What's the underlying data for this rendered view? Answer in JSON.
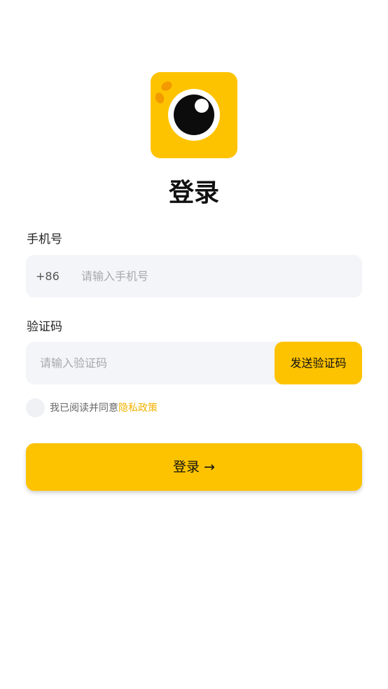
{
  "logo": {
    "icon": "camera-lens-icon",
    "color": "#fec300"
  },
  "title": "登录",
  "phone": {
    "label": "手机号",
    "prefix": "+86",
    "placeholder": "请输入手机号",
    "value": ""
  },
  "code": {
    "label": "验证码",
    "placeholder": "请输入验证码",
    "value": "",
    "send_label": "发送验证码"
  },
  "agreement": {
    "checked": false,
    "text": "我已阅读并同意",
    "link": "隐私政策"
  },
  "login_button": "登录 →",
  "colors": {
    "accent": "#fec300",
    "link": "#f2b200",
    "field_bg": "#f4f5f8"
  }
}
